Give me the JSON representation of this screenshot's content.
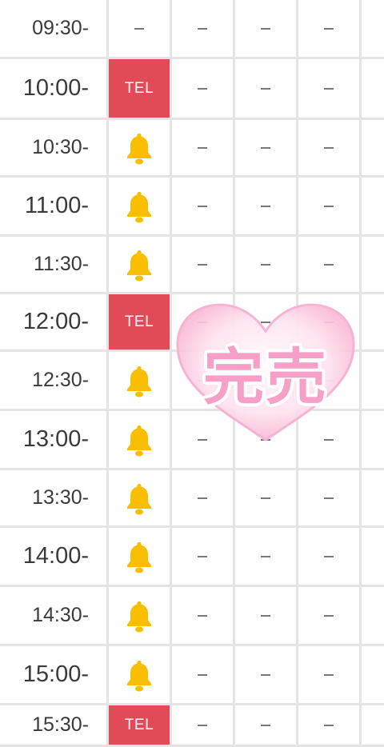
{
  "colors": {
    "tel_bg": "#e14a57",
    "bell": "#f9be00",
    "stamp_pink": "#f6a0c8",
    "grid_line": "#e4e4e4"
  },
  "icons": {
    "bell": "bell-icon",
    "stamp": "sold-out-heart-stamp"
  },
  "stamp": {
    "text": "完売"
  },
  "rows": [
    {
      "time": "09:30-",
      "first": "dash",
      "rest": [
        "–",
        "–",
        "–"
      ]
    },
    {
      "time": "10:00-",
      "first": "TEL",
      "rest": [
        "–",
        "–",
        "–"
      ]
    },
    {
      "time": "10:30-",
      "first": "bell",
      "rest": [
        "–",
        "–",
        "–"
      ]
    },
    {
      "time": "11:00-",
      "first": "bell",
      "rest": [
        "–",
        "–",
        "–"
      ]
    },
    {
      "time": "11:30-",
      "first": "bell",
      "rest": [
        "–",
        "–",
        "–"
      ]
    },
    {
      "time": "12:00-",
      "first": "TEL",
      "rest": [
        "–",
        "–",
        "–"
      ]
    },
    {
      "time": "12:30-",
      "first": "bell",
      "rest": [
        "–",
        "–",
        "–"
      ]
    },
    {
      "time": "13:00-",
      "first": "bell",
      "rest": [
        "–",
        "–",
        "–"
      ]
    },
    {
      "time": "13:30-",
      "first": "bell",
      "rest": [
        "–",
        "–",
        "–"
      ]
    },
    {
      "time": "14:00-",
      "first": "bell",
      "rest": [
        "–",
        "–",
        "–"
      ]
    },
    {
      "time": "14:30-",
      "first": "bell",
      "rest": [
        "–",
        "–",
        "–"
      ]
    },
    {
      "time": "15:00-",
      "first": "bell",
      "rest": [
        "–",
        "–",
        "–"
      ]
    },
    {
      "time": "15:30-",
      "first": "TEL",
      "rest": [
        "–",
        "–",
        "–"
      ]
    }
  ]
}
